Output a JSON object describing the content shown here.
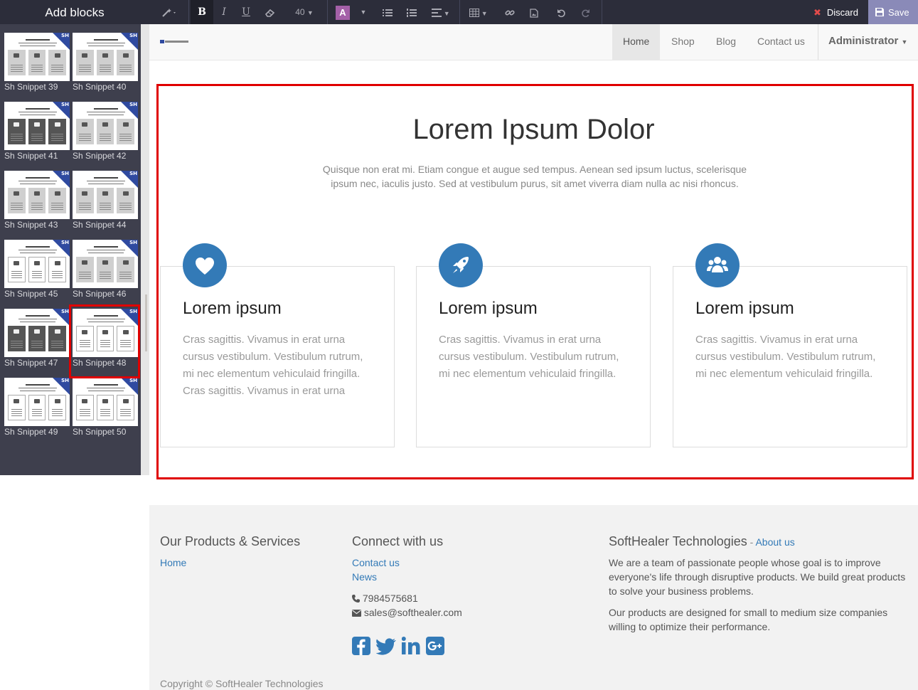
{
  "sidebar": {
    "title": "Add blocks",
    "badge": "SH",
    "snippets": [
      {
        "label": "Sh Snippet 39",
        "style": "grey"
      },
      {
        "label": "Sh Snippet 40",
        "style": "grey"
      },
      {
        "label": "Sh Snippet 41",
        "style": "dark"
      },
      {
        "label": "Sh Snippet 42",
        "style": "grey"
      },
      {
        "label": "Sh Snippet 43",
        "style": "grey"
      },
      {
        "label": "Sh Snippet 44",
        "style": "grey"
      },
      {
        "label": "Sh Snippet 45",
        "style": "white"
      },
      {
        "label": "Sh Snippet 46",
        "style": "grey"
      },
      {
        "label": "Sh Snippet 47",
        "style": "dark"
      },
      {
        "label": "Sh Snippet 48",
        "style": "white"
      },
      {
        "label": "Sh Snippet 49",
        "style": "white"
      },
      {
        "label": "Sh Snippet 50",
        "style": "white"
      }
    ],
    "selected": "Sh Snippet 48"
  },
  "toolbar": {
    "bold": "B",
    "italic": "I",
    "underline": "U",
    "font_size": "40",
    "color_label": "A",
    "discard_label": "Discard",
    "save_label": "Save",
    "accent_color": "#a460a8"
  },
  "nav": {
    "items": [
      "Home",
      "Shop",
      "Blog",
      "Contact us"
    ],
    "active": "Home",
    "user": "Administrator"
  },
  "hero": {
    "title": "Lorem Ipsum Dolor",
    "subtitle": "Quisque non erat mi. Etiam congue et augue sed tempus. Aenean sed ipsum luctus, scelerisque ipsum nec, iaculis justo. Sed at vestibulum purus, sit amet viverra diam nulla ac nisi rhoncus."
  },
  "cards": [
    {
      "icon": "heart-icon",
      "title": "Lorem ipsum",
      "text": "Cras sagittis. Vivamus in erat urna cursus vestibulum. Vestibulum rutrum, mi nec elementum vehiculaid fringilla. Cras sagittis. Vivamus in erat urna"
    },
    {
      "icon": "rocket-icon",
      "title": "Lorem ipsum",
      "text": "Cras sagittis. Vivamus in erat urna cursus vestibulum. Vestibulum rutrum, mi nec elementum vehiculaid fringilla."
    },
    {
      "icon": "users-icon",
      "title": "Lorem ipsum",
      "text": "Cras sagittis. Vivamus in erat urna cursus vestibulum. Vestibulum rutrum, mi nec elementum vehiculaid fringilla."
    }
  ],
  "footer": {
    "col1_title": "Our Products & Services",
    "col1_link": "Home",
    "col2_title": "Connect with us",
    "col2_link1": "Contact us",
    "col2_link2": "News",
    "phone": "7984575681",
    "email": "sales@softhealer.com",
    "col3_title": "SoftHealer Technologies",
    "col3_sep": " - ",
    "col3_link": "About us",
    "col3_p1": "We are a team of passionate people whose goal is to improve everyone's life through disruptive products. We build great products to solve your business problems.",
    "col3_p2": "Our products are designed for small to medium size companies willing to optimize their performance.",
    "copyright": "Copyright © SoftHealer Technologies",
    "link_color": "#337ab7",
    "icon_color": "#337ab7"
  }
}
